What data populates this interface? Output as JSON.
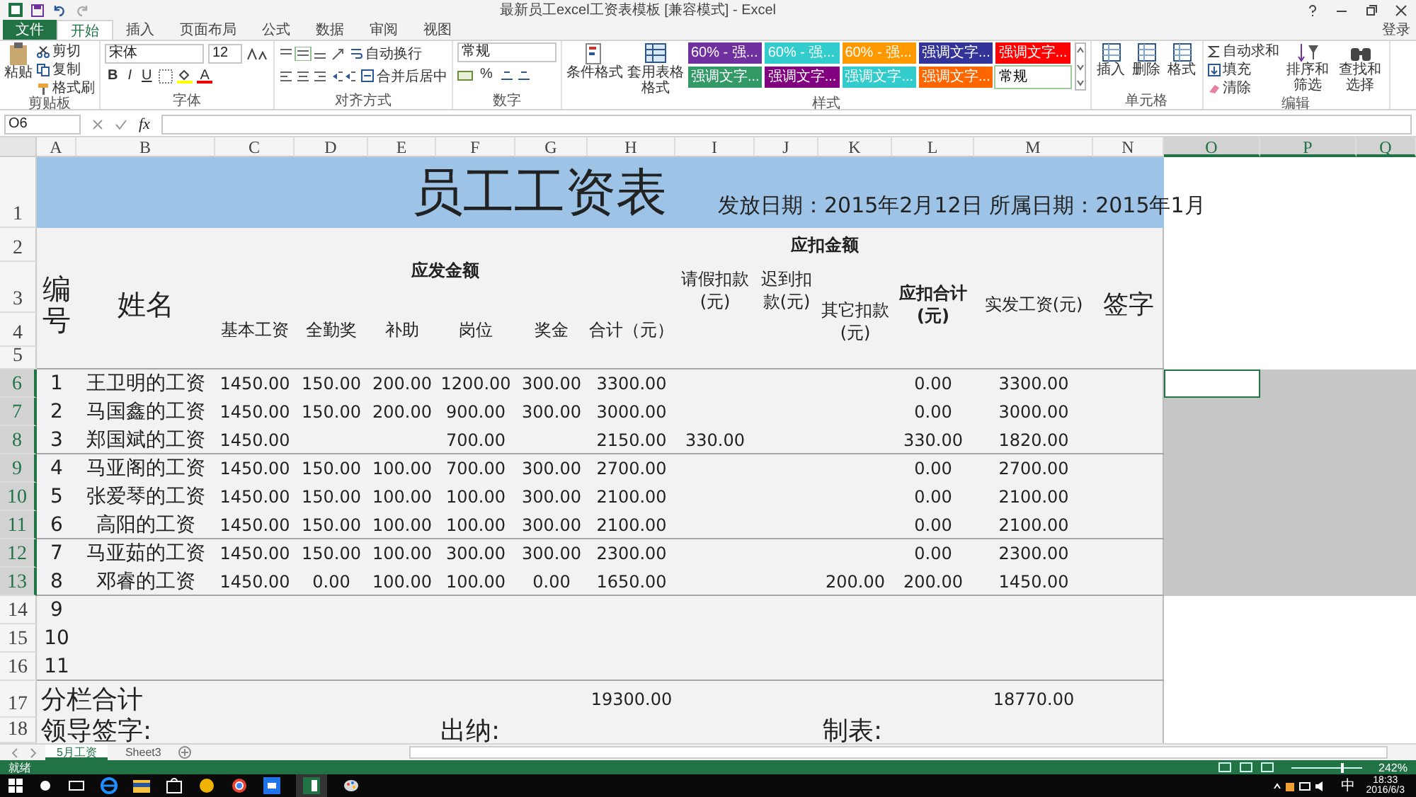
{
  "window": {
    "title": "最新员工excel工资表模板 [兼容模式] - Excel",
    "sign_in": "登录"
  },
  "tabs": [
    {
      "label": "文件",
      "kind": "file",
      "selected": false
    },
    {
      "label": "开始",
      "kind": "tab",
      "selected": true
    },
    {
      "label": "插入",
      "kind": "tab",
      "selected": false
    },
    {
      "label": "页面布局",
      "kind": "tab",
      "selected": false
    },
    {
      "label": "公式",
      "kind": "tab",
      "selected": false
    },
    {
      "label": "数据",
      "kind": "tab",
      "selected": false
    },
    {
      "label": "审阅",
      "kind": "tab",
      "selected": false
    },
    {
      "label": "视图",
      "kind": "tab",
      "selected": false
    }
  ],
  "ribbon": {
    "clipboard": {
      "label": "剪贴板",
      "paste": "粘贴",
      "cut": "剪切",
      "copy": "复制",
      "format_painter": "格式刷"
    },
    "font": {
      "label": "字体",
      "name": "宋体",
      "size": "12",
      "bold": "B",
      "italic": "I",
      "underline": "U",
      "font_color": "A"
    },
    "alignment": {
      "label": "对齐方式",
      "wrap": "自动换行",
      "merge": "合并后居中"
    },
    "number": {
      "label": "数字",
      "format": "常规",
      "percent": "%"
    },
    "styles": {
      "label": "样式",
      "conditional": "条件格式",
      "table": "套用表格格式",
      "cell_styles": [
        {
          "label": "60% - 强...",
          "color": "#7030a0"
        },
        {
          "label": "60% - 强...",
          "color": "#33cccc"
        },
        {
          "label": "60% - 强...",
          "color": "#ff9900"
        },
        {
          "label": "强调文字...",
          "color": "#333399"
        },
        {
          "label": "强调文字...",
          "color": "#ff0000"
        },
        {
          "label": "强调文字...",
          "color": "#339966"
        },
        {
          "label": "强调文字...",
          "color": "#800080"
        },
        {
          "label": "强调文字...",
          "color": "#33cccc"
        },
        {
          "label": "强调文字...",
          "color": "#ff6600"
        },
        {
          "label": "常规",
          "color": "#ffffff"
        }
      ]
    },
    "cells": {
      "label": "单元格",
      "buttons": [
        "插入",
        "删除",
        "格式"
      ]
    },
    "editing": {
      "label": "编辑",
      "autosum": "自动求和",
      "fill": "填充",
      "clear": "清除",
      "sort": "排序和筛选",
      "find": "查找和选择"
    }
  },
  "formula_bar": {
    "name_box": "O6",
    "fx": "fx"
  },
  "sheet": {
    "columns": [
      {
        "label": "A",
        "selected": false
      },
      {
        "label": "B",
        "selected": false
      },
      {
        "label": "C",
        "selected": false
      },
      {
        "label": "D",
        "selected": false
      },
      {
        "label": "E",
        "selected": false
      },
      {
        "label": "F",
        "selected": false
      },
      {
        "label": "G",
        "selected": false
      },
      {
        "label": "H",
        "selected": false
      },
      {
        "label": "I",
        "selected": false
      },
      {
        "label": "J",
        "selected": false
      },
      {
        "label": "K",
        "selected": false
      },
      {
        "label": "L",
        "selected": false
      },
      {
        "label": "M",
        "selected": false
      },
      {
        "label": "N",
        "selected": false
      },
      {
        "label": "O",
        "selected": true
      },
      {
        "label": "P",
        "selected": true
      },
      {
        "label": "Q",
        "selected": true
      }
    ],
    "row_numbers": [
      {
        "label": "1",
        "selected": false
      },
      {
        "label": "2",
        "selected": false
      },
      {
        "label": "3",
        "selected": false
      },
      {
        "label": "4",
        "selected": false
      },
      {
        "label": "5",
        "selected": false
      },
      {
        "label": "6",
        "selected": true
      },
      {
        "label": "7",
        "selected": true
      },
      {
        "label": "8",
        "selected": true
      },
      {
        "label": "9",
        "selected": true
      },
      {
        "label": "10",
        "selected": true
      },
      {
        "label": "11",
        "selected": true
      },
      {
        "label": "12",
        "selected": true
      },
      {
        "label": "13",
        "selected": true
      },
      {
        "label": "14",
        "selected": false
      },
      {
        "label": "15",
        "selected": false
      },
      {
        "label": "16",
        "selected": false
      },
      {
        "label": "17",
        "selected": false
      },
      {
        "label": "18",
        "selected": false
      }
    ],
    "title": "员工工资表",
    "dates": "发放日期：2015年2月12日 所属日期：2015年1月",
    "headers": {
      "no": "编号",
      "name": "姓名",
      "payable": "应发金额",
      "payable_items": [
        "基本工资",
        "全勤奖",
        "补助",
        "岗位",
        "奖金",
        "合计（元）"
      ],
      "deductions": "应扣金额",
      "leave": "请假扣款(元)",
      "late": "迟到扣款(元)",
      "other": "其它扣款(元)",
      "deduct_total": "应扣合计(元)",
      "net": "实发工资(元)",
      "signature": "签字"
    },
    "rows": [
      {
        "no": "1",
        "name": "王卫明的工资",
        "basic": "1450.00",
        "attendance": "150.00",
        "allowance": "200.00",
        "post": "1200.00",
        "bonus": "300.00",
        "total": "3300.00",
        "deduct_total": "0.00",
        "net": "3300.00",
        "divider_below": false
      },
      {
        "no": "2",
        "name": "马国鑫的工资",
        "basic": "1450.00",
        "attendance": "150.00",
        "allowance": "200.00",
        "post": "900.00",
        "bonus": "300.00",
        "total": "3000.00",
        "deduct_total": "0.00",
        "net": "3000.00",
        "divider_below": false
      },
      {
        "no": "3",
        "name": "郑国斌的工资",
        "basic": "1450.00",
        "post": "700.00",
        "total": "2150.00",
        "leave": "330.00",
        "deduct_total": "330.00",
        "net": "1820.00",
        "divider_below": true
      },
      {
        "no": "4",
        "name": "马亚阁的工资",
        "basic": "1450.00",
        "attendance": "150.00",
        "allowance": "100.00",
        "post": "700.00",
        "bonus": "300.00",
        "total": "2700.00",
        "deduct_total": "0.00",
        "net": "2700.00",
        "divider_below": false
      },
      {
        "no": "5",
        "name": "张爱琴的工资",
        "basic": "1450.00",
        "attendance": "150.00",
        "allowance": "100.00",
        "post": "100.00",
        "bonus": "300.00",
        "total": "2100.00",
        "deduct_total": "0.00",
        "net": "2100.00",
        "divider_below": false
      },
      {
        "no": "6",
        "name": "高阳的工资",
        "basic": "1450.00",
        "attendance": "150.00",
        "allowance": "100.00",
        "post": "100.00",
        "bonus": "300.00",
        "total": "2100.00",
        "deduct_total": "0.00",
        "net": "2100.00",
        "divider_below": true
      },
      {
        "no": "7",
        "name": "马亚茹的工资",
        "basic": "1450.00",
        "attendance": "150.00",
        "allowance": "100.00",
        "post": "300.00",
        "bonus": "300.00",
        "total": "2300.00",
        "deduct_total": "0.00",
        "net": "2300.00",
        "divider_below": false
      },
      {
        "no": "8",
        "name": "邓睿的工资",
        "basic": "1450.00",
        "attendance": "0.00",
        "allowance": "100.00",
        "post": "100.00",
        "bonus": "0.00",
        "total": "1650.00",
        "other": "200.00",
        "deduct_total": "200.00",
        "net": "1450.00",
        "divider_below": true
      },
      {
        "no": "9",
        "divider_below": false
      },
      {
        "no": "10",
        "divider_below": false
      },
      {
        "no": "11",
        "divider_below": true
      }
    ],
    "totals": {
      "label": "分栏合计",
      "total": "19300.00",
      "net": "18770.00"
    },
    "signatures": [
      "领导签字:",
      "出纳:",
      "制表:"
    ]
  },
  "sheet_tabs": [
    {
      "label": "5月工资",
      "selected": true
    },
    {
      "label": "Sheet3",
      "selected": false
    }
  ],
  "status_bar": {
    "status": "就绪",
    "zoom": {
      "level": 0.7,
      "reading": "242%"
    }
  },
  "taskbar": {
    "ime": "中",
    "time": "18:33",
    "date": "2016/6/3"
  }
}
